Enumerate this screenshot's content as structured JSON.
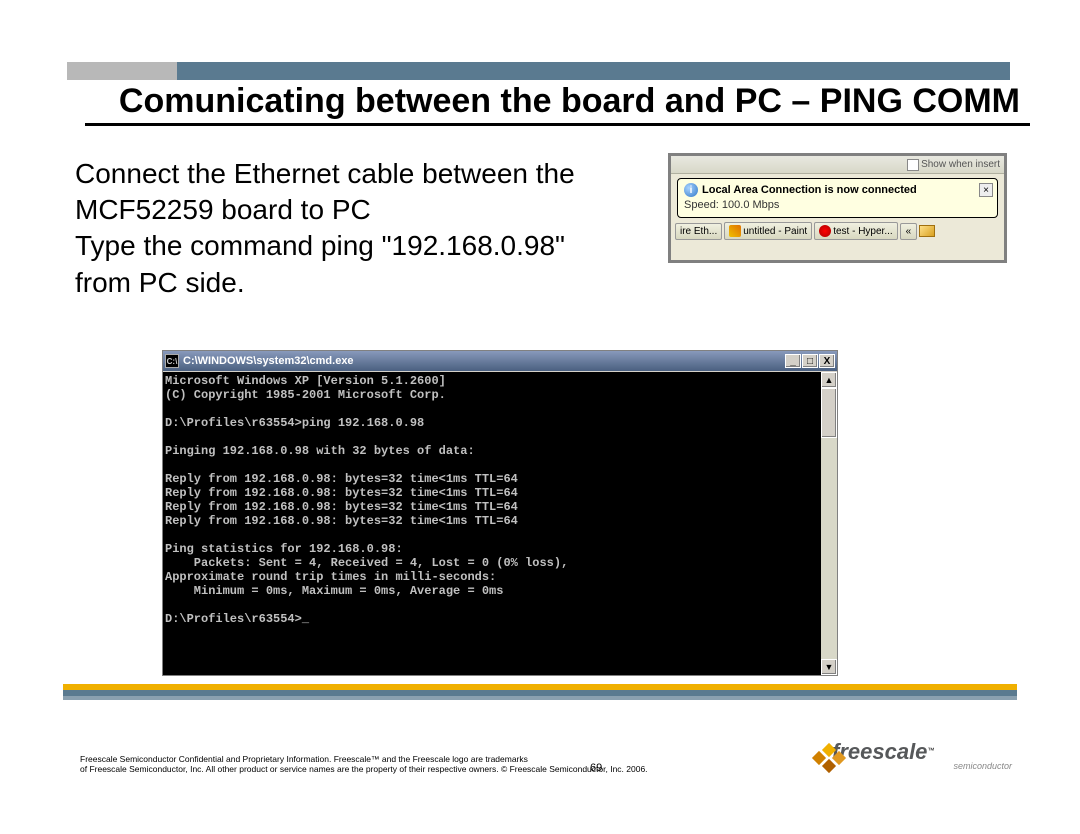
{
  "header": {
    "title": "Comunicating between the board and PC – PING COMM"
  },
  "body": {
    "line1": "Connect the Ethernet cable between the",
    "line2": "MCF52259 board to PC",
    "line3": "Type the command ping \"192.168.0.98\"",
    "line4": "from PC side."
  },
  "notification": {
    "top_text": "Show when insert",
    "title": "Local Area Connection is now connected",
    "speed": "Speed: 100.0 Mbps",
    "taskbar_items": [
      "ire Eth...",
      "untitled - Paint",
      "test - Hyper..."
    ],
    "chevron": "«"
  },
  "cmd": {
    "title": "C:\\WINDOWS\\system32\\cmd.exe",
    "icon_label": "C:\\",
    "lines": [
      "Microsoft Windows XP [Version 5.1.2600]",
      "(C) Copyright 1985-2001 Microsoft Corp.",
      "",
      "D:\\Profiles\\r63554>ping 192.168.0.98",
      "",
      "Pinging 192.168.0.98 with 32 bytes of data:",
      "",
      "Reply from 192.168.0.98: bytes=32 time<1ms TTL=64",
      "Reply from 192.168.0.98: bytes=32 time<1ms TTL=64",
      "Reply from 192.168.0.98: bytes=32 time<1ms TTL=64",
      "Reply from 192.168.0.98: bytes=32 time<1ms TTL=64",
      "",
      "Ping statistics for 192.168.0.98:",
      "    Packets: Sent = 4, Received = 4, Lost = 0 (0% loss),",
      "Approximate round trip times in milli-seconds:",
      "    Minimum = 0ms, Maximum = 0ms, Average = 0ms",
      "",
      "D:\\Profiles\\r63554>_"
    ],
    "btn_min": "_",
    "btn_max": "□",
    "btn_close": "X",
    "scroll_up": "▲",
    "scroll_down": "▼"
  },
  "footer": {
    "line1": "Freescale Semiconductor Confidential and Proprietary Information. Freescale™ and the Freescale logo are trademarks",
    "line2": "of Freescale Semiconductor, Inc. All other product or service names are the property of their respective owners. © Freescale Semiconductor, Inc. 2006.",
    "page": "69",
    "logo_text": "freescale",
    "logo_tm": "™",
    "logo_sub": "semiconductor"
  }
}
